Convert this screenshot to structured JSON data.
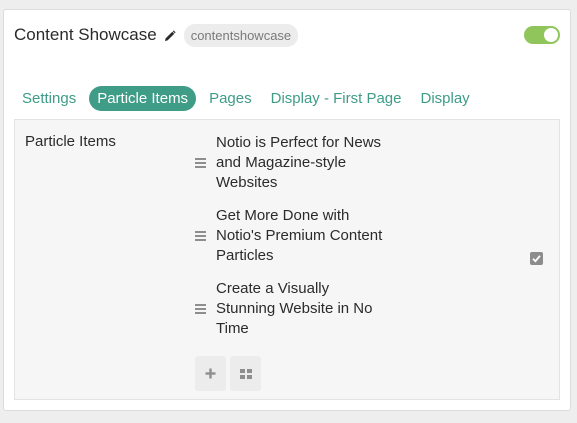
{
  "header": {
    "title": "Content Showcase",
    "edit_icon": "pencil-icon",
    "slug": "contentshowcase",
    "toggle_state": "on",
    "toggle_color": "#8fc55a"
  },
  "tabs": [
    {
      "label": "Settings",
      "active": false
    },
    {
      "label": "Particle Items",
      "active": true
    },
    {
      "label": "Pages",
      "active": false
    },
    {
      "label": "Display - First Page",
      "active": false
    },
    {
      "label": "Display",
      "active": false
    }
  ],
  "accent_color": "#3e9c87",
  "section": {
    "label": "Particle Items",
    "items": [
      {
        "text": "Notio is Perfect for News and Magazine-style Websites",
        "icon": "drag-handle-icon"
      },
      {
        "text": "Get More Done with Notio's Premium Content Particles",
        "icon": "drag-handle-icon"
      },
      {
        "text": "Create a Visually Stunning Website in No Time",
        "icon": "drag-handle-icon"
      }
    ],
    "override_checked": true,
    "actions": [
      {
        "icon": "plus-icon"
      },
      {
        "icon": "grid-icon"
      }
    ]
  }
}
